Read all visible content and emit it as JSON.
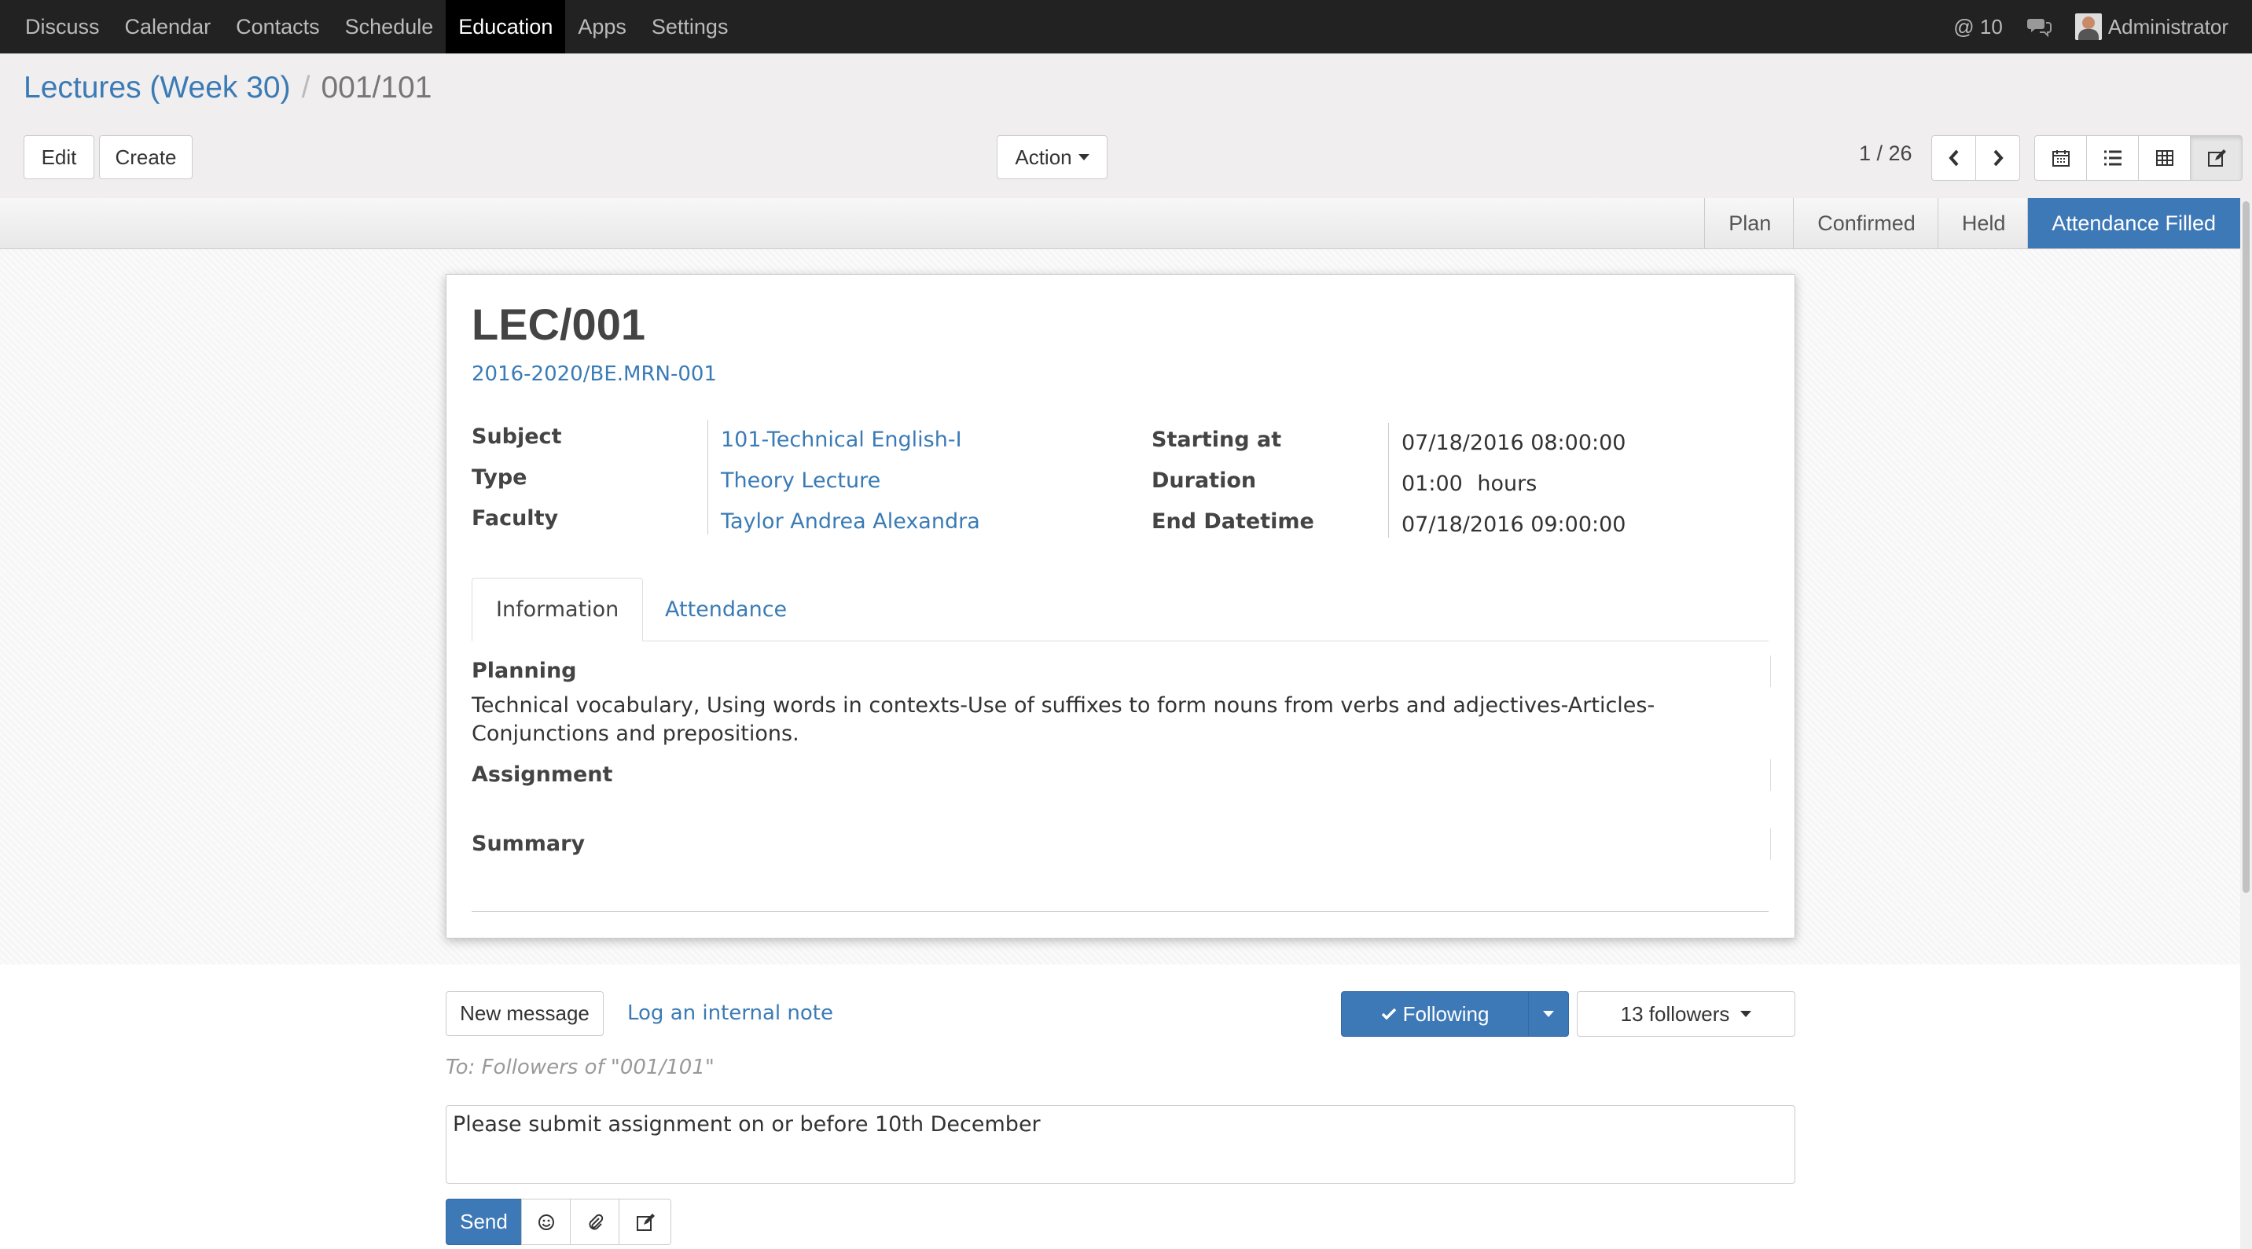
{
  "nav": {
    "items": [
      {
        "label": "Discuss"
      },
      {
        "label": "Calendar"
      },
      {
        "label": "Contacts"
      },
      {
        "label": "Schedule"
      },
      {
        "label": "Education"
      },
      {
        "label": "Apps"
      },
      {
        "label": "Settings"
      }
    ],
    "active": "Education",
    "mentions": "@ 10",
    "user": "Administrator"
  },
  "breadcrumb": {
    "parent": "Lectures (Week 30)",
    "separator": "/",
    "current": "001/101"
  },
  "toolbar": {
    "edit_label": "Edit",
    "create_label": "Create",
    "action_label": "Action",
    "pager": "1 / 26"
  },
  "status": {
    "stages": [
      "Plan",
      "Confirmed",
      "Held",
      "Attendance Filled"
    ],
    "current": "Attendance Filled"
  },
  "record": {
    "name": "LEC/001",
    "batch": "2016-2020/BE.MRN-001",
    "fields": {
      "subject_label": "Subject",
      "subject": "101-Technical English-I",
      "type_label": "Type",
      "type": "Theory Lecture",
      "faculty_label": "Faculty",
      "faculty": "Taylor Andrea Alexandra",
      "start_label": "Starting at",
      "start": "07/18/2016 08:00:00",
      "duration_label": "Duration",
      "duration": "01:00",
      "duration_unit": "hours",
      "end_label": "End Datetime",
      "end": "07/18/2016 09:00:00"
    },
    "tabs": [
      "Information",
      "Attendance"
    ],
    "active_tab": "Information",
    "planning_label": "Planning",
    "planning": "Technical vocabulary, Using words in contexts-Use of suffixes to form nouns from verbs and adjectives-Articles-Conjunctions and prepositions.",
    "assignment_label": "Assignment",
    "summary_label": "Summary"
  },
  "chatter": {
    "new_message": "New message",
    "log_note": "Log an internal note",
    "following": "Following",
    "followers": "13 followers",
    "to": "To: Followers of \"001/101\"",
    "message": "Please submit assignment on or before 10th December",
    "send": "Send"
  },
  "colors": {
    "accent": "#3d78b7",
    "link": "#3a7bb6",
    "topbar": "#222222"
  }
}
